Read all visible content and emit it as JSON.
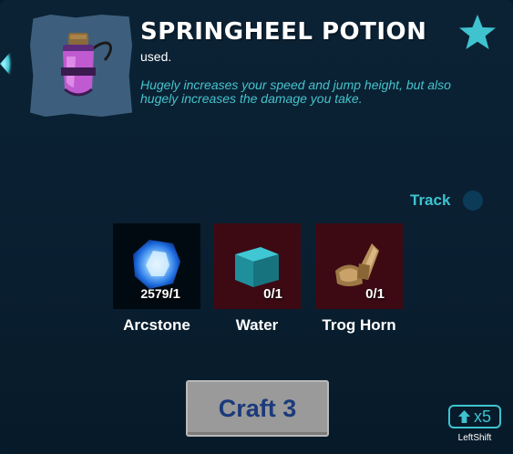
{
  "item": {
    "name": "SPRINGHEEL POTION",
    "subtitle": "used.",
    "description": "Hugely increases your speed and jump height, but also hugely increases the damage you take.",
    "quantity": "3",
    "icon": "potion-icon",
    "favorite_icon": "star-icon"
  },
  "track": {
    "label": "Track",
    "enabled": false
  },
  "ingredients": [
    {
      "name": "Arcstone",
      "have": "2579",
      "need": "/1",
      "icon": "arcstone-icon",
      "status": "ok"
    },
    {
      "name": "Water",
      "have": "0",
      "need": "/1",
      "icon": "water-cube-icon",
      "status": "missing"
    },
    {
      "name": "Trog Horn",
      "have": "0",
      "need": "/1",
      "icon": "trog-horn-icon",
      "status": "missing"
    }
  ],
  "craft": {
    "label": "Craft 3"
  },
  "multiplier": {
    "label": "x5",
    "key_hint": "LeftShift"
  },
  "colors": {
    "accent": "#3ec3cf",
    "missing": "#3d0a14",
    "craft_text": "#1b3a7a"
  }
}
